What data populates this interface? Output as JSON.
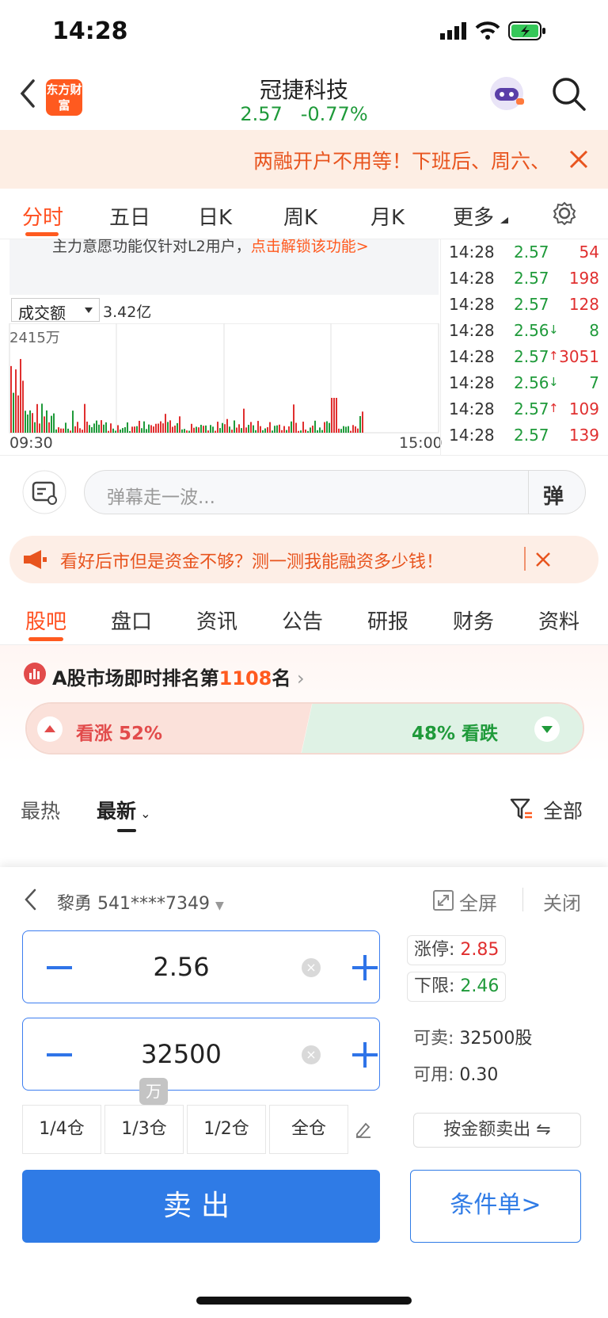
{
  "status_bar": {
    "time": "14:28"
  },
  "header": {
    "logo_text": "东方财富",
    "stock_name": "冠捷科技",
    "price": "2.57",
    "change_pct": "-0.77%"
  },
  "promo": {
    "text": "两融开户不用等！下班后、周六、"
  },
  "chart_tabs": [
    {
      "label": "分时"
    },
    {
      "label": "五日"
    },
    {
      "label": "日K"
    },
    {
      "label": "周K"
    },
    {
      "label": "月K"
    },
    {
      "label": "更多"
    }
  ],
  "chart": {
    "l2_notice": "主力意愿功能仅针对L2用户，",
    "l2_link": "点击解锁该功能>",
    "volume_selector": "成交额",
    "volume_value": "3.42亿",
    "y_max_label": "2415万",
    "x_start": "09:30",
    "x_end": "15:00"
  },
  "ticks": [
    {
      "time": "14:28",
      "price": "2.57",
      "arrow": "",
      "vol": "54",
      "vol_color": "#e02f2f",
      "price_color": "#1f9a3a"
    },
    {
      "time": "14:28",
      "price": "2.57",
      "arrow": "",
      "vol": "198",
      "vol_color": "#e02f2f",
      "price_color": "#1f9a3a"
    },
    {
      "time": "14:28",
      "price": "2.57",
      "arrow": "",
      "vol": "128",
      "vol_color": "#e02f2f",
      "price_color": "#1f9a3a"
    },
    {
      "time": "14:28",
      "price": "2.56",
      "arrow": "↓",
      "vol": "8",
      "vol_color": "#1f9a3a",
      "price_color": "#1f9a3a"
    },
    {
      "time": "14:28",
      "price": "2.57",
      "arrow": "↑",
      "vol": "3051",
      "vol_color": "#e02f2f",
      "price_color": "#1f9a3a"
    },
    {
      "time": "14:28",
      "price": "2.56",
      "arrow": "↓",
      "vol": "7",
      "vol_color": "#1f9a3a",
      "price_color": "#1f9a3a"
    },
    {
      "time": "14:28",
      "price": "2.57",
      "arrow": "↑",
      "vol": "109",
      "vol_color": "#e02f2f",
      "price_color": "#1f9a3a"
    },
    {
      "time": "14:28",
      "price": "2.57",
      "arrow": "",
      "vol": "139",
      "vol_color": "#e02f2f",
      "price_color": "#1f9a3a"
    }
  ],
  "danmu": {
    "placeholder": "弹幕走一波...",
    "send_label": "弹"
  },
  "financing_banner": {
    "text": "看好后市但是资金不够？测一测我能融资多少钱！"
  },
  "section_tabs": [
    {
      "label": "股吧"
    },
    {
      "label": "盘口"
    },
    {
      "label": "资讯"
    },
    {
      "label": "公告"
    },
    {
      "label": "研报"
    },
    {
      "label": "财务"
    },
    {
      "label": "资料"
    }
  ],
  "ranking": {
    "prefix": "A股市场即时排名第",
    "rank": "1108",
    "suffix": "名",
    "bull_label": "看涨 52%",
    "bear_label": "48% 看跌",
    "bull_fraction": 0.52
  },
  "feed_filter": {
    "hot": "最热",
    "latest": "最新",
    "all": "全部"
  },
  "trade": {
    "account_name": "黎勇",
    "account_no": "541****7349",
    "fullscreen": "全屏",
    "close": "关闭",
    "price_value": "2.56",
    "qty_value": "32500",
    "qty_unit_hint": "万",
    "limit_up_label": "涨停:",
    "limit_up_value": "2.85",
    "limit_down_label": "下限:",
    "limit_down_value": "2.46",
    "sellable_label": "可卖:",
    "sellable_value": "32500股",
    "available_label": "可用:",
    "available_value": "0.30",
    "positions": [
      "1/4仓",
      "1/3仓",
      "1/2仓",
      "全仓"
    ],
    "sell_by_amount": "按金额卖出 ⇋",
    "sell_button": "卖出",
    "conditional_order": "条件单>"
  },
  "colors": {
    "accent": "#ff5a1f",
    "up": "#e02f2f",
    "down": "#1f9a3a",
    "trade_blue": "#2f7be6"
  }
}
